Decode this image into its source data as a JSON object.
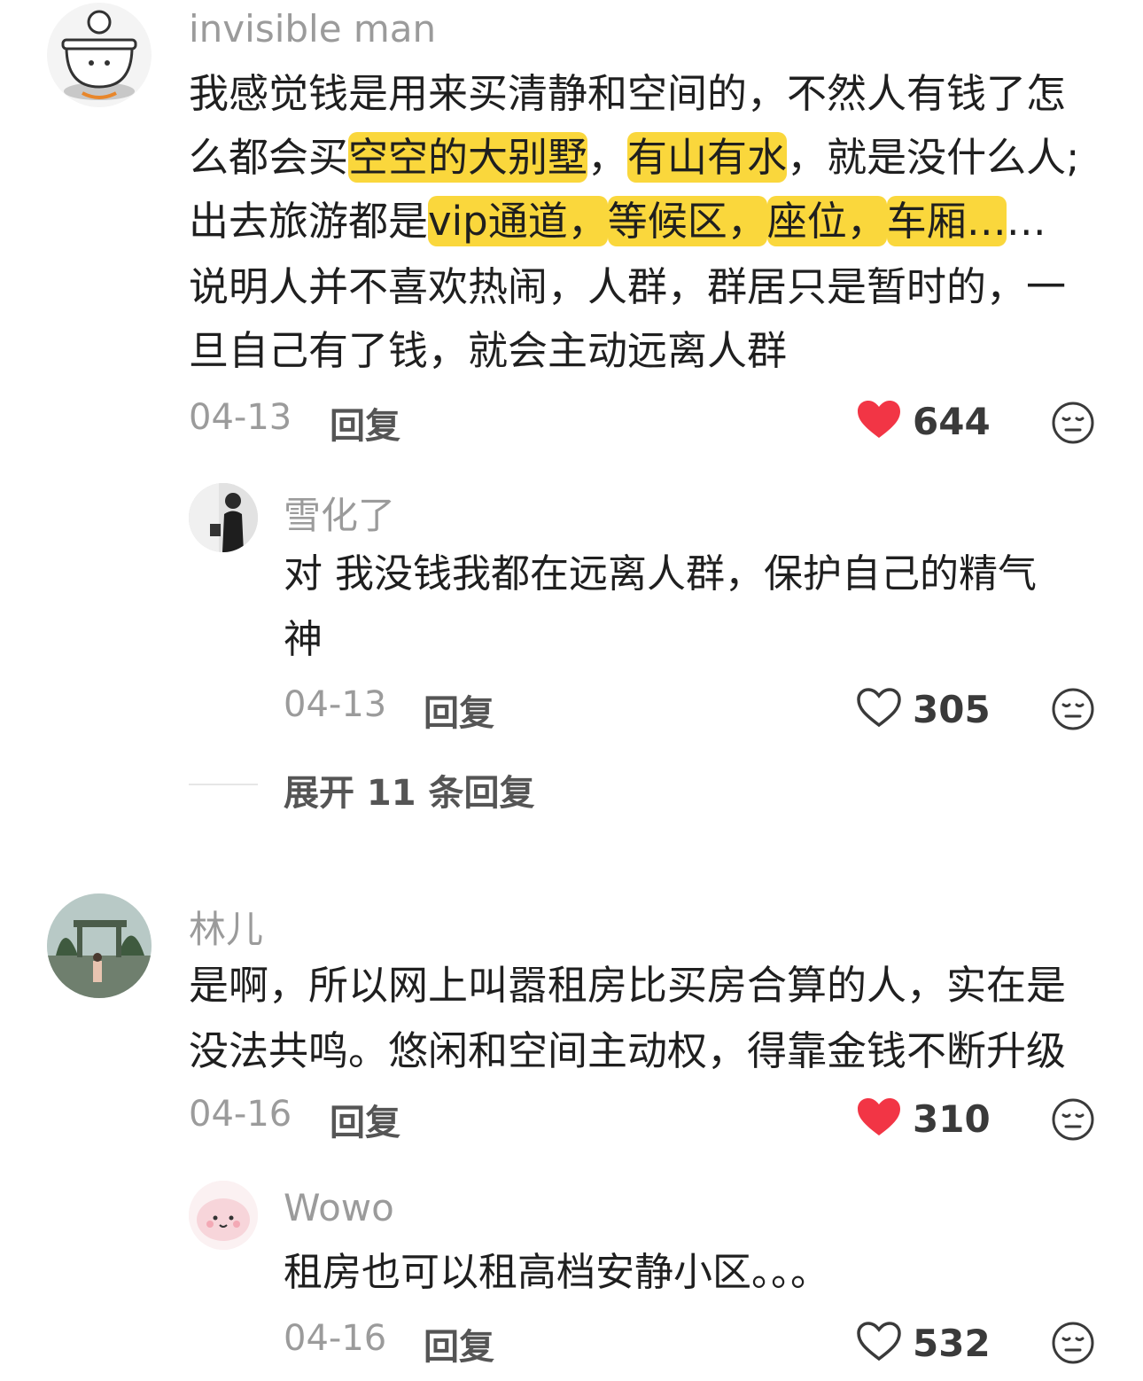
{
  "colors": {
    "highlight": "#fad73c",
    "like_red": "#f23545",
    "muted": "#9b9b9b"
  },
  "comments": [
    {
      "username": "invisible man",
      "avatar_icon": "cooking-pot-cartoon-avatar",
      "lines": [
        [
          {
            "t": "我感觉钱是用来买清静和空间的，不然人有钱了怎"
          }
        ],
        [
          {
            "t": "么都会买"
          },
          {
            "t": "空空的大别墅",
            "hl": true
          },
          {
            "t": "，"
          },
          {
            "t": "有山有水",
            "hl": true
          },
          {
            "t": "，就是没什么人;"
          }
        ],
        [
          {
            "t": "出去旅游都是"
          },
          {
            "t": "vip通道，",
            "hl": true
          },
          {
            "t": "等候区，",
            "hl": true
          },
          {
            "t": "座位，",
            "hl": true
          },
          {
            "t": "车厢…",
            "hl": true
          },
          {
            "t": "…"
          }
        ],
        [
          {
            "t": "说明人并不喜欢热闹，人群，群居只是暂时的，一"
          }
        ],
        [
          {
            "t": "旦自己有了钱，就会主动远离人群"
          }
        ]
      ],
      "date": "04-13",
      "reply_label": "回复",
      "likes": "644",
      "liked": true,
      "reply": {
        "username": "雪化了",
        "avatar_icon": "person-photo-avatar",
        "lines": [
          "对 我没钱我都在远离人群，保护自己的精气",
          "神"
        ],
        "date": "04-13",
        "reply_label": "回复",
        "likes": "305",
        "liked": false
      },
      "expand_label": "展开 11 条回复"
    },
    {
      "username": "林儿",
      "avatar_icon": "garden-photo-avatar",
      "lines": [
        [
          {
            "t": "是啊，所以网上叫嚣租房比买房合算的人，实在是"
          }
        ],
        [
          {
            "t": "没法共鸣。悠闲和空间主动权，得靠金钱不断升级"
          }
        ]
      ],
      "date": "04-16",
      "reply_label": "回复",
      "likes": "310",
      "liked": true,
      "reply": {
        "username": "Wowo",
        "avatar_icon": "pink-cartoon-avatar",
        "lines": [
          "租房也可以租高档安静小区。。。"
        ],
        "date": "04-16",
        "reply_label": "回复",
        "likes": "532",
        "liked": false
      }
    }
  ]
}
